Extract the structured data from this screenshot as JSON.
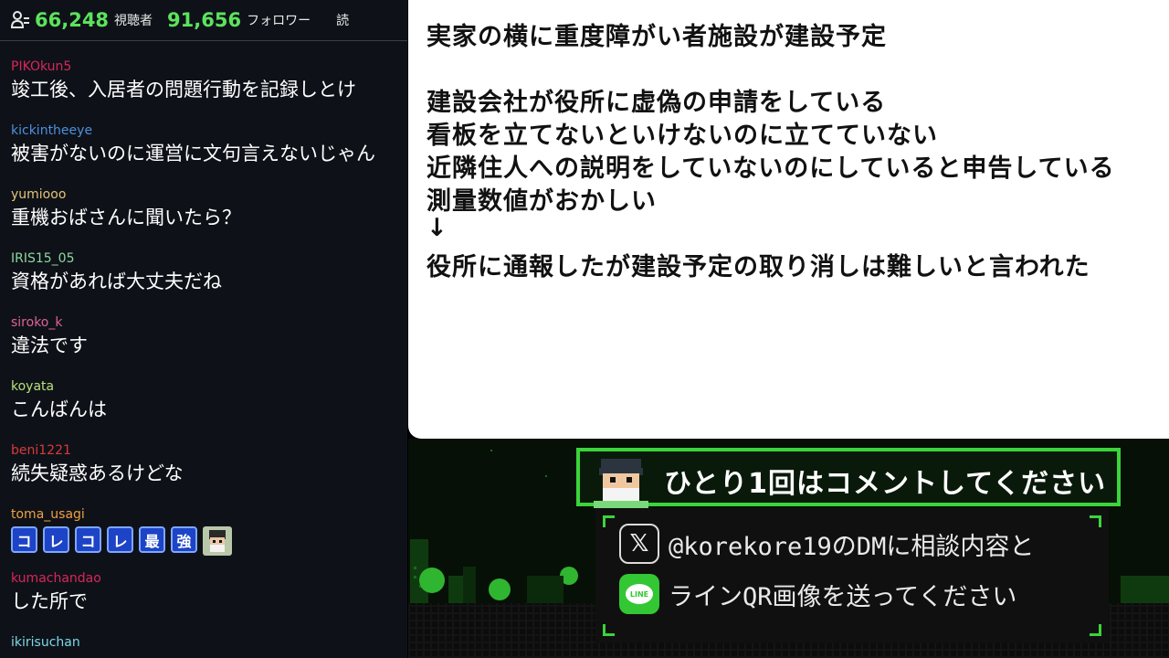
{
  "stats": {
    "viewers": "66,248",
    "viewers_label": "視聴者",
    "followers": "91,656",
    "followers_label": "フォロワー",
    "truncated": "読"
  },
  "messages": [
    {
      "user": "PIKOkun5",
      "color": "#d9265b",
      "text": "竣工後、入居者の問題行動を記録しとけ"
    },
    {
      "user": "kickintheeye",
      "color": "#4d8fe0",
      "text": "被害がないのに運営に文句言えないじゃん"
    },
    {
      "user": "yumiooo",
      "color": "#e6c37a",
      "text": "重機おばさんに聞いたら？"
    },
    {
      "user": "IRIS15_05",
      "color": "#8fd6a0",
      "text": "資格があれば大丈夫だね"
    },
    {
      "user": "siroko_k",
      "color": "#e0609a",
      "text": "違法です"
    },
    {
      "user": "koyata",
      "color": "#b9e07a",
      "text": "こんばんは"
    },
    {
      "user": "beni1221",
      "color": "#d83a3a",
      "text": "続失疑惑あるけどな"
    },
    {
      "user": "toma_usagi",
      "color": "#f0a040",
      "emotes": [
        "コ",
        "レ",
        "コ",
        "レ",
        "最",
        "強"
      ]
    },
    {
      "user": "kumachandao",
      "color": "#d9265b",
      "text": "した所で"
    },
    {
      "user": "ikirisuchan",
      "color": "#7fd7e8",
      "text": ""
    }
  ],
  "notice": {
    "lines": [
      "実家の横に重度障がい者施設が建設予定",
      "",
      "建設会社が役所に虚偽の申請をしている",
      "看板を立てないといけないのに立てていない",
      "近隣住人への説明をしていないのにしていると申告している",
      "測量数値がおかしい",
      "↓",
      "役所に通報したが建設予定の取り消しは難しいと言われた"
    ]
  },
  "cta": {
    "text": "ひとり1回はコメントしてください"
  },
  "contact": {
    "x_icon": "x-logo-icon",
    "x_text": "@korekore19のDMに相談内容と",
    "line_icon": "line-app-icon",
    "line_badge": "LINE",
    "line_text": "ラインQR画像を送ってください"
  },
  "colors": {
    "accent_green": "#3bd43b",
    "stat_green": "#5ce35c"
  }
}
